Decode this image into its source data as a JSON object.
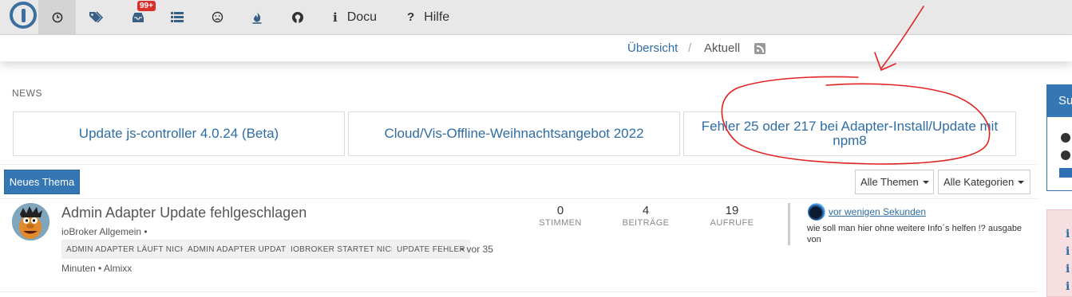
{
  "topnav": {
    "items": [
      {
        "icon": "clock-icon"
      },
      {
        "icon": "tags-icon"
      },
      {
        "icon": "inbox-icon",
        "badge": "99+"
      },
      {
        "icon": "list-icon"
      },
      {
        "icon": "frown-icon"
      },
      {
        "icon": "fire-icon"
      },
      {
        "icon": "github-icon"
      }
    ],
    "docu_label": "Docu",
    "hilfe_label": "Hilfe"
  },
  "breadcrumb": {
    "overview": "Übersicht",
    "separator": "/",
    "current": "Aktuell"
  },
  "news": {
    "label": "NEWS",
    "cards": [
      "Update js-controller 4.0.24 (Beta)",
      "Cloud/Vis-Offline-Weihnachtsangebot 2022",
      "Fehler 25 oder 217 bei Adapter-Install/Update mit npm8"
    ]
  },
  "toolbar": {
    "new_topic": "Neues Thema",
    "filter_topics": "Alle Themen",
    "filter_categories": "Alle Kategorien"
  },
  "topic": {
    "title": "Admin Adapter Update fehlgeschlagen",
    "category": "ioBroker Allgemein •",
    "tags": [
      "ADMIN ADAPTER LÄUFT NICHT",
      "ADMIN ADAPTER UPDATE",
      "IOBROKER STARTET NICHT",
      "UPDATE FEHLER"
    ],
    "meta_after_tags": "• vor 35",
    "meta_line2": "Minuten • Almixx",
    "stats": [
      {
        "value": "0",
        "label": "STIMMEN"
      },
      {
        "value": "4",
        "label": "BEITRÄGE"
      },
      {
        "value": "19",
        "label": "AUFRUFE"
      }
    ],
    "teaser_time": "vor wenigen Sekunden",
    "teaser_text": "wie soll man hier ohne weitere Info´s helfen !? ausgabe von"
  },
  "side": {
    "panel_head": "Su"
  },
  "colors": {
    "accent": "#3576b4",
    "link": "#2f6da4",
    "badge": "#d9302c",
    "annotation": "#e32222"
  }
}
